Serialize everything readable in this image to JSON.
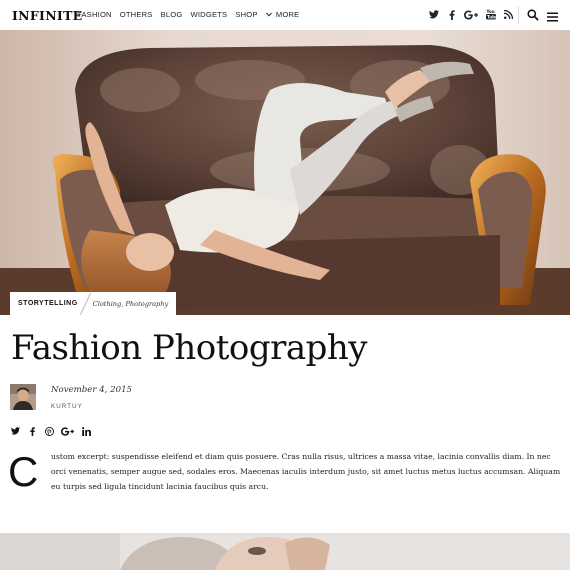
{
  "site": {
    "logo": "INFINITE"
  },
  "nav": {
    "items": [
      "FASHION",
      "OTHERS",
      "BLOG",
      "WIDGETS",
      "SHOP"
    ],
    "more_label": "MORE"
  },
  "header_icons": [
    "twitter-icon",
    "facebook-icon",
    "google-plus-icon",
    "youtube-icon",
    "rss-icon",
    "search-icon",
    "menu-icon"
  ],
  "post": {
    "category_tag": "STORYTELLING",
    "tags": "Clothing, Photography",
    "title": "Fashion Photography",
    "date": "November 4, 2015",
    "author": "KURTUY",
    "share_icons": [
      "twitter-icon",
      "facebook-icon",
      "pinterest-icon",
      "google-plus-icon",
      "linkedin-icon"
    ],
    "dropcap": "C",
    "excerpt": "ustom excerpt: suspendisse eleifend et diam quis posuere. Cras nulla risus, ultrices a massa vitae, lacinia convallis diam. In nec orci venenatis, semper augue sed, sodales eros. Maecenas iaculis interdum justo, sit amet luctus metus luctus accumsan. Aliquam eu turpis sed ligula tincidunt lacinia faucibus quis arcu."
  },
  "colors": {
    "text": "#111111",
    "accent": "#e0a04a"
  }
}
